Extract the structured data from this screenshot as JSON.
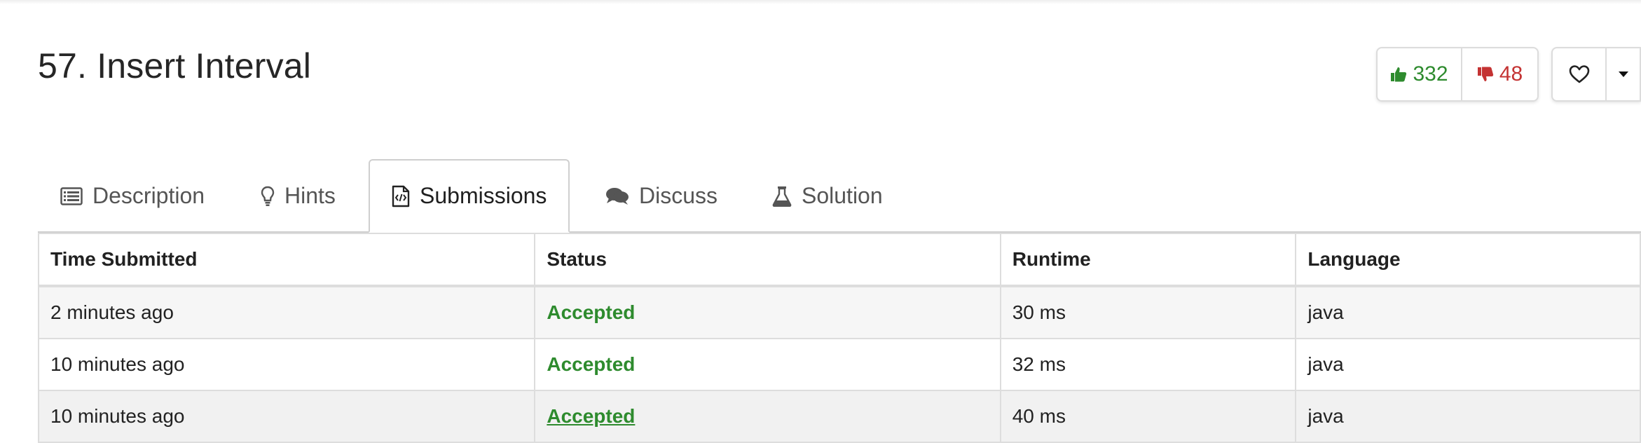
{
  "problem": {
    "title": "57. Insert Interval"
  },
  "votes": {
    "likes": "332",
    "dislikes": "48",
    "like_color": "#2e8b2e",
    "dislike_color": "#c43333"
  },
  "tabs": [
    {
      "label": "Description",
      "icon": "list-icon"
    },
    {
      "label": "Hints",
      "icon": "lightbulb-icon"
    },
    {
      "label": "Submissions",
      "icon": "code-file-icon",
      "active": true
    },
    {
      "label": "Discuss",
      "icon": "comments-icon"
    },
    {
      "label": "Solution",
      "icon": "flask-icon"
    }
  ],
  "table": {
    "headers": [
      "Time Submitted",
      "Status",
      "Runtime",
      "Language"
    ],
    "rows": [
      {
        "time": "2 minutes ago",
        "status": "Accepted",
        "runtime": "30 ms",
        "language": "java"
      },
      {
        "time": "10 minutes ago",
        "status": "Accepted",
        "runtime": "32 ms",
        "language": "java"
      },
      {
        "time": "10 minutes ago",
        "status": "Accepted",
        "runtime": "40 ms",
        "language": "java"
      }
    ]
  }
}
